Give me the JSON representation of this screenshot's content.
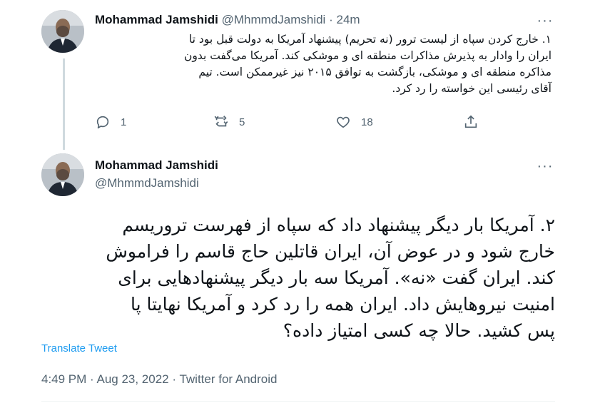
{
  "tweets": [
    {
      "author": {
        "name": "Mohammad Jamshidi",
        "handle": "@MhmmdJamshidi"
      },
      "separator": "·",
      "time_ago": "24m",
      "text": "۱. خارج کردن سپاه از لیست ترور (نه تحریم) پیشنهاد آمریکا به دولت قبل بود تا\nایران را وادار به پذیرش مذاکرات منطقه ای و موشکی کند. آمریکا می‌گفت بدون\nمذاکره منطقه ای و موشکی، بازگشت به توافق ۲۰۱۵ نیز غیرممکن است. تیم\nآقای رئیسی این خواسته را رد کرد.",
      "metrics": {
        "replies": "1",
        "retweets": "5",
        "likes": "18"
      },
      "icons": [
        "reply-icon",
        "retweet-icon",
        "like-icon",
        "share-icon",
        "more-icon"
      ]
    },
    {
      "author": {
        "name": "Mohammad Jamshidi",
        "handle": "@MhmmdJamshidi"
      },
      "text": "۲. آمریکا بار دیگر پیشنهاد داد که سپاه از فهرست تروریسم\nخارج شود و در عوض آن، ایران قاتلین حاج قاسم را فراموش\nکند. ایران گفت «نه». آمریکا سه بار دیگر پیشنهادهایی برای\nامنیت نیروهایش داد. ایران همه را رد کرد و آمریکا نهایتا پا\nپس کشید. حالا چه کسی امتیاز داده؟",
      "translate_label": "Translate Tweet",
      "timestamp": "4:49 PM · Aug 23, 2022",
      "separator": "·",
      "source": "Twitter for Android"
    }
  ],
  "colors": {
    "text": "#0f1419",
    "secondary": "#536471",
    "link": "#1d9bf0",
    "thread_line": "#cfd9de"
  }
}
